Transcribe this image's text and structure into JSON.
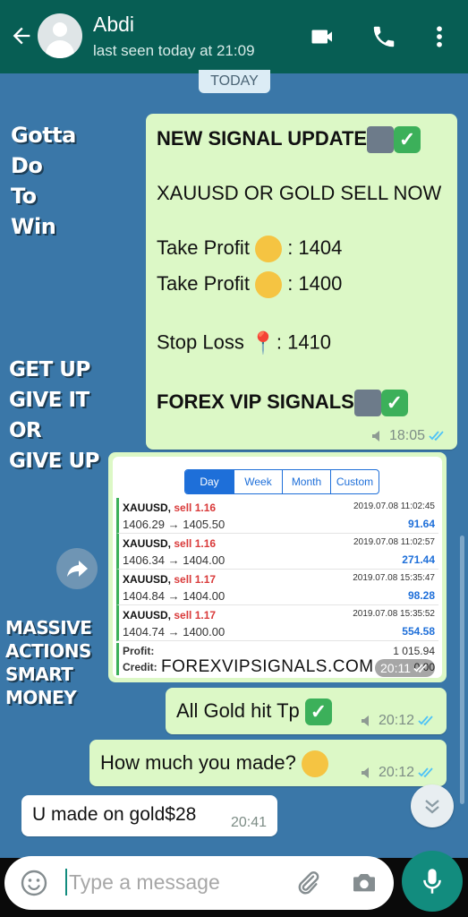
{
  "header": {
    "contact_name": "Abdi",
    "last_seen": "last seen today at 21:09",
    "bg_color": "#075e54"
  },
  "date_chip": "TODAY",
  "wallpaper": {
    "slogan1": [
      "Gotta",
      "Do",
      "To",
      "Win"
    ],
    "slogan2": [
      "GET UP",
      "GIVE IT",
      "OR",
      "GIVE UP"
    ],
    "slogan3": [
      "MASSIVE",
      "ACTIONS",
      "SMART",
      "MONEY"
    ]
  },
  "signal_message": {
    "line1": "NEW SIGNAL UPDATE",
    "line2": "XAUUSD OR GOLD SELL NOW",
    "tp1_label": "Take Profit",
    "tp1_value": ": 1404",
    "tp2_label": "Take Profit",
    "tp2_value": ": 1400",
    "sl_label": "Stop Loss",
    "sl_value": ": 1410",
    "footer": "FOREX VIP SIGNALS",
    "time": "18:05"
  },
  "image_message": {
    "tabs": [
      "Day",
      "Week",
      "Month",
      "Custom"
    ],
    "active_tab": "Day",
    "trades": [
      {
        "symbol": "XAUUSD,",
        "side": "sell 1.16",
        "prices": "1406.29 → 1405.50",
        "datetime": "2019.07.08 11:02:45",
        "profit": "91.64"
      },
      {
        "symbol": "XAUUSD,",
        "side": "sell 1.16",
        "prices": "1406.34 → 1404.00",
        "datetime": "2019.07.08 11:02:57",
        "profit": "271.44"
      },
      {
        "symbol": "XAUUSD,",
        "side": "sell 1.17",
        "prices": "1404.84 → 1404.00",
        "datetime": "2019.07.08 15:35:47",
        "profit": "98.28"
      },
      {
        "symbol": "XAUUSD,",
        "side": "sell 1.17",
        "prices": "1404.74 → 1400.00",
        "datetime": "2019.07.08 15:35:52",
        "profit": "554.58"
      }
    ],
    "profit_label": "Profit:",
    "profit_value": "1 015.94",
    "credit_label": "Credit:",
    "credit_value": "0.00",
    "watermark": "FOREXVIPSIGNALS.COM",
    "time": "20:11"
  },
  "messages": [
    {
      "text": "All Gold hit Tp",
      "time": "20:12"
    },
    {
      "text": "How much you made?",
      "time": "20:12"
    },
    {
      "text": "U made on gold$28",
      "time": "20:41"
    }
  ],
  "composer": {
    "placeholder": "Type a message"
  },
  "colors": {
    "outgoing_bubble": "#dcf8c6",
    "incoming_bubble": "#ffffff",
    "read_ticks": "#4fc3f7",
    "accent": "#128c7e"
  }
}
